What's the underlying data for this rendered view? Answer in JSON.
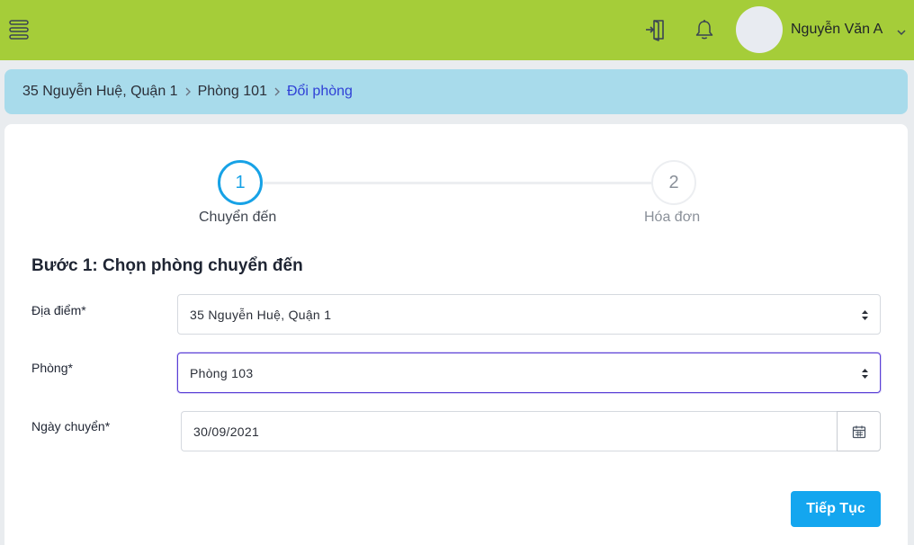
{
  "header": {
    "menu_icon": "menu-icon",
    "logout_icon": "logout-icon",
    "notification_icon": "bell-icon",
    "user_name": "Nguyễn Văn A",
    "colors": {
      "background": "#a5cd39",
      "avatar": "#e8ebf1"
    }
  },
  "breadcrumb": {
    "items": [
      {
        "label": "35 Nguyễn Huệ, Quận 1"
      },
      {
        "label": "Phòng 101"
      },
      {
        "label": "Đổi phòng",
        "active": true
      }
    ],
    "colors": {
      "background": "#a8dbeb",
      "active": "#2f40d6"
    }
  },
  "stepper": {
    "steps": [
      {
        "number": "1",
        "label": "Chuyển đến",
        "active": true
      },
      {
        "number": "2",
        "label": "Hóa đơn",
        "active": false
      }
    ],
    "colors": {
      "active": "#17a2e6",
      "inactive": "#8a9099"
    }
  },
  "form": {
    "title": "Bước 1: Chọn phòng chuyển đến",
    "location": {
      "label": "Địa điểm*",
      "value": "35 Nguyễn Huệ, Quận 1"
    },
    "room": {
      "label": "Phòng*",
      "value": "Phòng 103"
    },
    "move_date": {
      "label": "Ngày chuyển*",
      "value": "30/09/2021",
      "button_icon": "calendar-icon"
    },
    "submit_label": "Tiếp Tục",
    "colors": {
      "submit": "#14a6ef",
      "focus_border": "#5a3fd6"
    }
  }
}
